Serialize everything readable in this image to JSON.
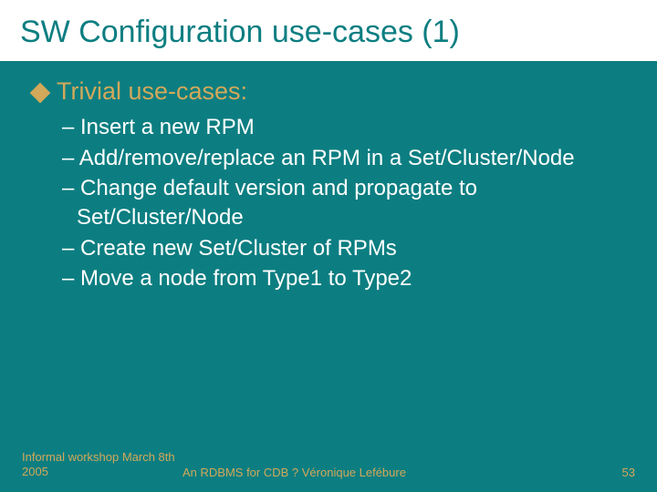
{
  "title": "SW Configuration use-cases (1)",
  "bullet": {
    "label": "Trivial use-cases:"
  },
  "items": [
    "– Insert a new RPM",
    "– Add/remove/replace an RPM in a Set/Cluster/Node",
    "– Change default version and propagate to Set/Cluster/Node",
    "– Create new Set/Cluster of RPMs",
    "– Move a node from Type1 to Type2"
  ],
  "footer": {
    "left": "Informal workshop March 8th 2005",
    "center": "An RDBMS for CDB ? Véronique Lefébure",
    "right": "53"
  }
}
